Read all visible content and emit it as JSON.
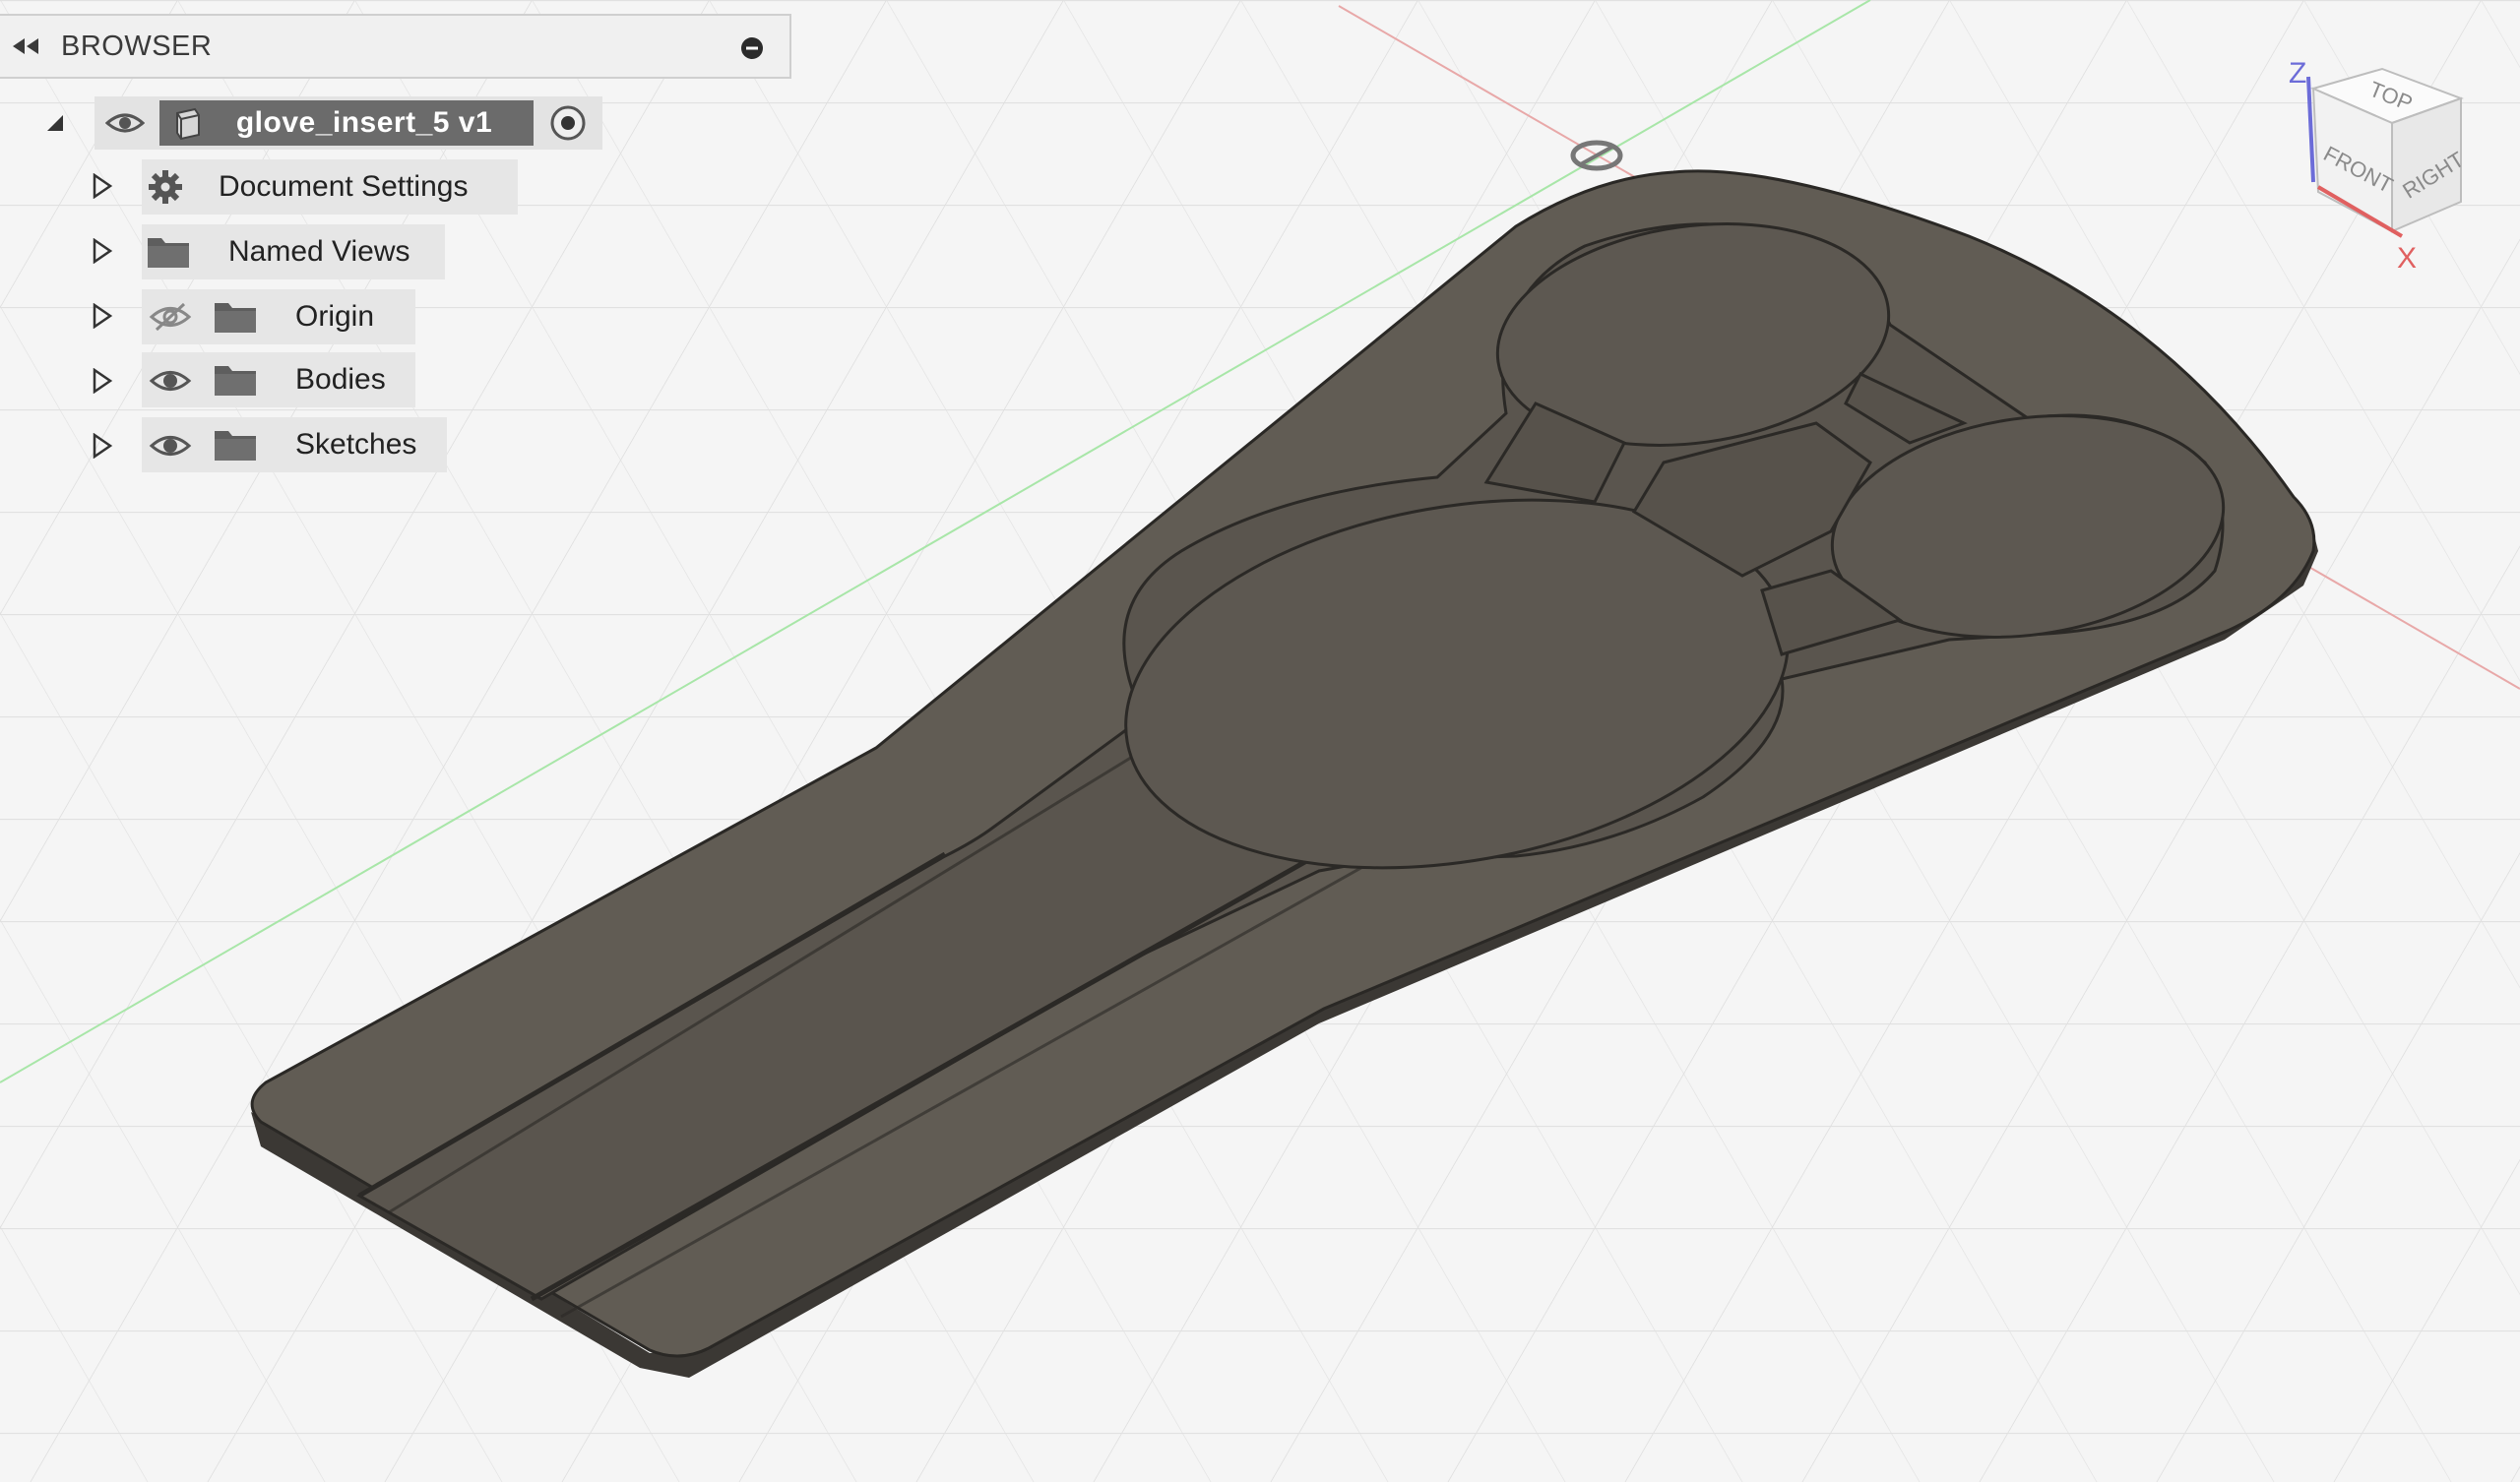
{
  "browser": {
    "title": "BROWSER",
    "root": {
      "label": "glove_insert_5 v1"
    },
    "items": [
      {
        "label": "Document Settings",
        "icon": "gear-icon"
      },
      {
        "label": "Named Views",
        "icon": "folder-icon"
      },
      {
        "label": "Origin",
        "icon": "folder-icon",
        "visibility": "hidden"
      },
      {
        "label": "Bodies",
        "icon": "folder-icon",
        "visibility": "visible"
      },
      {
        "label": "Sketches",
        "icon": "folder-icon",
        "visibility": "visible"
      }
    ]
  },
  "viewcube": {
    "faces": {
      "top": "TOP",
      "front": "FRONT",
      "right": "RIGHT"
    },
    "axes": {
      "z": "Z",
      "x": "X"
    }
  },
  "colors": {
    "part_fill": "#5f5a52",
    "part_edge": "#2a2825",
    "grid": "#dcdcdc",
    "x_axis": "#e29a9a",
    "y_axis": "#9ee39e",
    "selection": "#6b6b6b"
  }
}
